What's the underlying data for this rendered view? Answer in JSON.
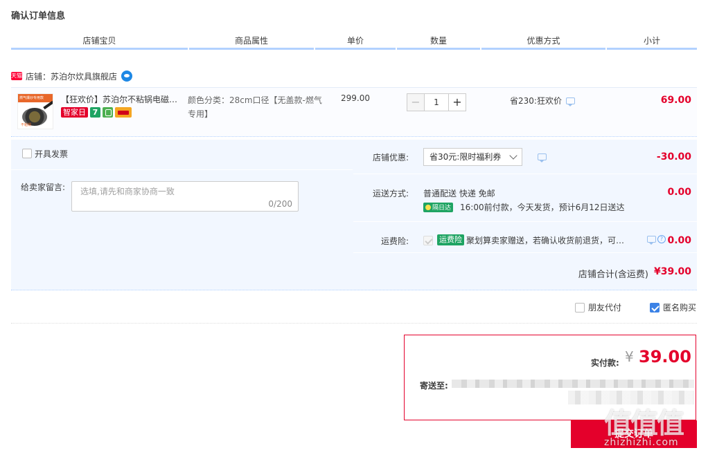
{
  "page": {
    "title": "确认订单信息"
  },
  "columns": [
    "店铺宝贝",
    "商品属性",
    "单价",
    "数量",
    "优惠方式",
    "小计"
  ],
  "shop": {
    "badge": "天猫",
    "name": "店铺：苏泊尔炊具旗舰店"
  },
  "item": {
    "thumb_top": "燃气爆炒专用款",
    "thumb_bottom": "不粘锅",
    "title": "【狂欢价】苏泊尔不粘锅电磁炉燃气灶炒锅",
    "tag_event": "智家日",
    "tag_seven": "7",
    "attr": "颜色分类：28cm口径【无盖款-燃气专用】",
    "price": "299.00",
    "qty_minus": "−",
    "qty": "1",
    "qty_plus": "+",
    "discount": "省230:狂欢价",
    "subtotal": "69.00"
  },
  "invoice": {
    "label": "开具发票",
    "checked": false
  },
  "memo": {
    "label": "给卖家留言:",
    "placeholder": "选填,请先和商家协商一致",
    "count": "0/200"
  },
  "shop_discount": {
    "label": "店铺优惠:",
    "selected": "省30元:限时福利券",
    "amount": "-30.00"
  },
  "shipping": {
    "label": "运送方式:",
    "method": "普通配送 快递 免邮",
    "badge": "隔日达",
    "note": "16:00前付款，今天发货，预计6月12日送达",
    "amount": "0.00"
  },
  "insurance": {
    "label": "运费险:",
    "tag": "运费险",
    "text": "聚划算卖家赠送，若确认收货前退货，可获得运费补偿",
    "help": "?",
    "amount": "0.00"
  },
  "shop_total": {
    "label": "店铺合计(含运费)",
    "amount": "¥39.00"
  },
  "options": {
    "friend_pay": "朋友代付",
    "anonymous": "匿名购买"
  },
  "payment": {
    "label": "实付款:",
    "currency": "¥",
    "amount": "39.00",
    "ship_to_label": "寄送至:"
  },
  "submit": {
    "label": "提交订单"
  },
  "watermark": {
    "glyphs": "值值值",
    "url": "zhizhizhi.com"
  },
  "colors": {
    "accent_red": "#e4002b",
    "header_rule": "#b2d1ff",
    "panel_bg": "#f2f7ff",
    "green_tag": "#1fa463",
    "checkbox_blue": "#3b82e6"
  }
}
